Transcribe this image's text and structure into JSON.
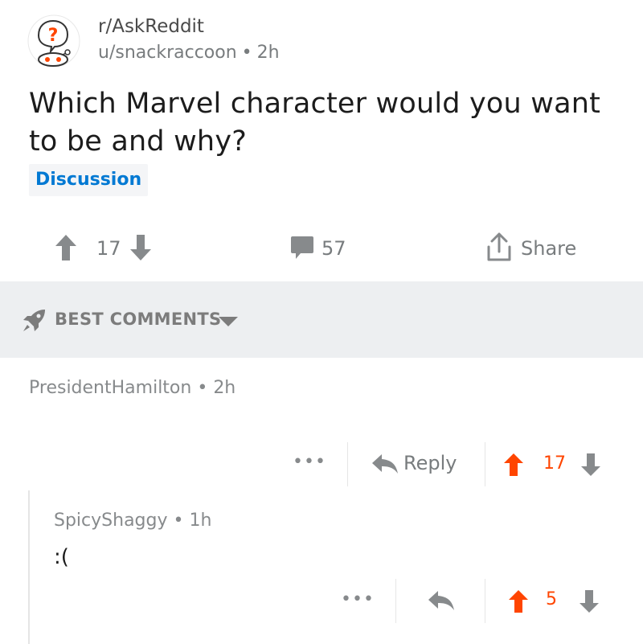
{
  "post": {
    "subreddit": "r/AskReddit",
    "author": "u/snackraccoon",
    "age": "2h",
    "title": "Which Marvel character would you want to be and why?",
    "flair": "Discussion",
    "score": "17",
    "comments_count": "57",
    "share_label": "Share"
  },
  "sort": {
    "label": "BEST COMMENTS"
  },
  "comments": [
    {
      "author": "PresidentHamilton",
      "age": "2h",
      "more_label": "•••",
      "reply_label": "Reply",
      "score": "17",
      "vote": "upvoted"
    },
    {
      "author": "SpicyShaggy",
      "age": "1h",
      "body": ":(",
      "more_label": "•••",
      "score": "5",
      "vote": "upvoted"
    }
  ],
  "colors": {
    "upvote": "#ff4500",
    "flair_text": "#0079d3",
    "muted": "#878a8c",
    "band": "#edeff1"
  },
  "icons": {
    "subreddit_avatar": "askreddit-snoo-icon",
    "upvote": "arrow-up-icon",
    "downvote": "arrow-down-icon",
    "comments": "comment-bubble-icon",
    "share": "share-icon",
    "sort": "rocket-icon",
    "reply": "reply-icon"
  }
}
